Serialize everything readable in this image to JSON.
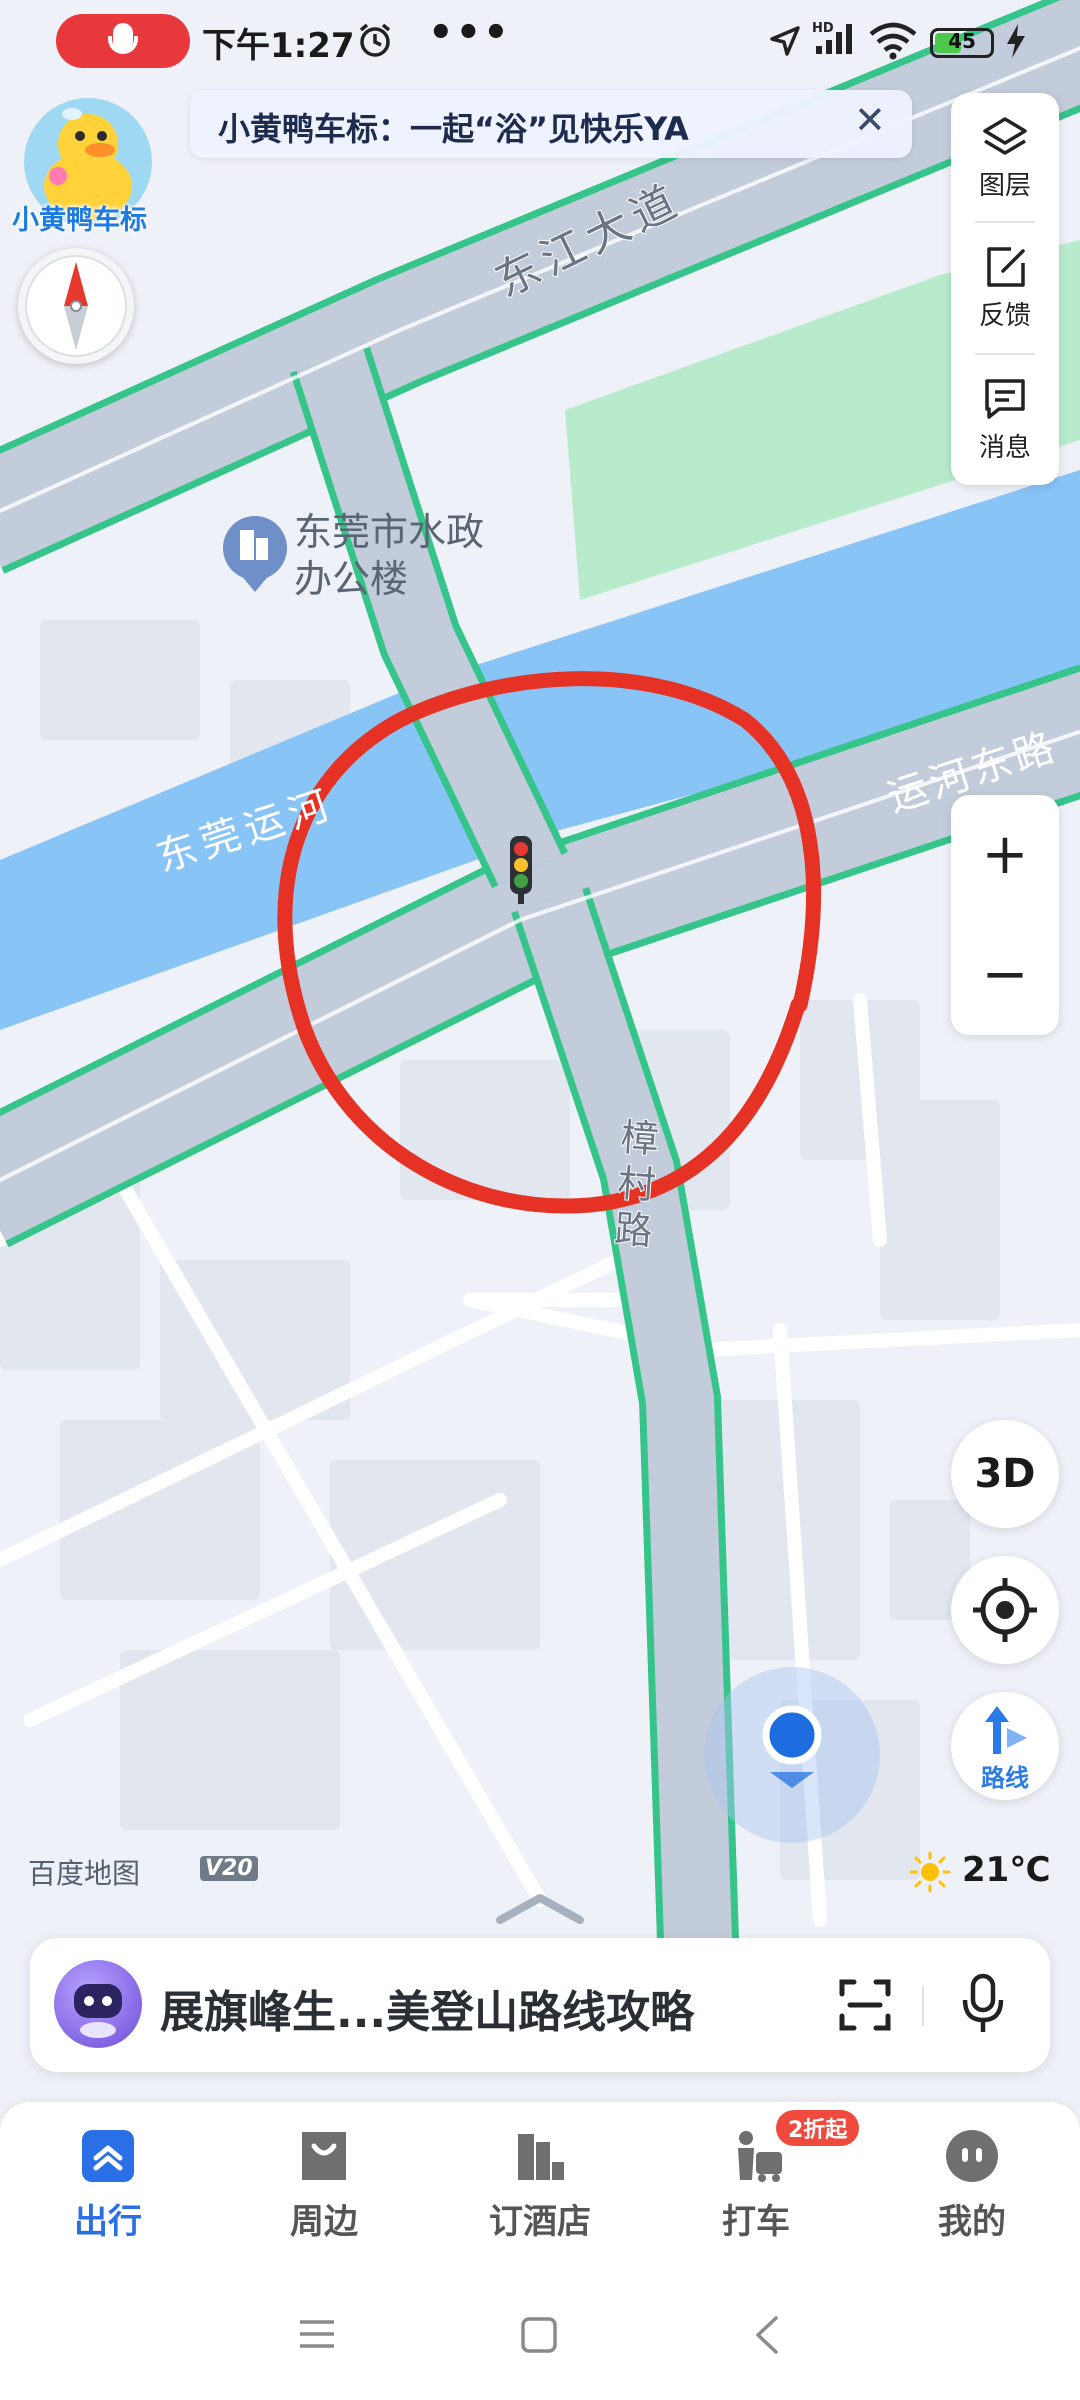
{
  "status_bar": {
    "time": "下午1:27",
    "dots": "•••",
    "battery": "45"
  },
  "notice": {
    "text": "小黄鸭车标：一起“浴”见快乐YA",
    "close": "✕"
  },
  "avatar": {
    "label": "小黄鸭车标"
  },
  "toolbar": {
    "layers_label": "图层",
    "feedback_label": "反馈",
    "messages_label": "消息"
  },
  "map": {
    "labels": {
      "dongjiang": "东江大道",
      "building_line1": "东莞市水政",
      "building_line2": "办公楼",
      "canal": "东莞运河",
      "yunhe_road": "运河东路",
      "zhangcun_road": "樟村路"
    },
    "brand": "百度地图",
    "version": "V20"
  },
  "zoom": {
    "in": "+",
    "out": "−"
  },
  "view": {
    "mode_3d": "3D",
    "route_label": "路线"
  },
  "weather": {
    "temp": "21℃"
  },
  "search": {
    "text": "展旗峰生...美登山路线攻略"
  },
  "nav": {
    "items": [
      {
        "label": "出行",
        "active": true
      },
      {
        "label": "周边"
      },
      {
        "label": "订酒店"
      },
      {
        "label": "打车",
        "badge": "2折起"
      },
      {
        "label": "我的"
      }
    ]
  },
  "colors": {
    "accent": "#2a6fe6",
    "river": "#89c4f7",
    "road": "#c3ccda",
    "road_edge": "#35c48a",
    "park": "#b8ebcc",
    "annotation": "#e53224"
  }
}
